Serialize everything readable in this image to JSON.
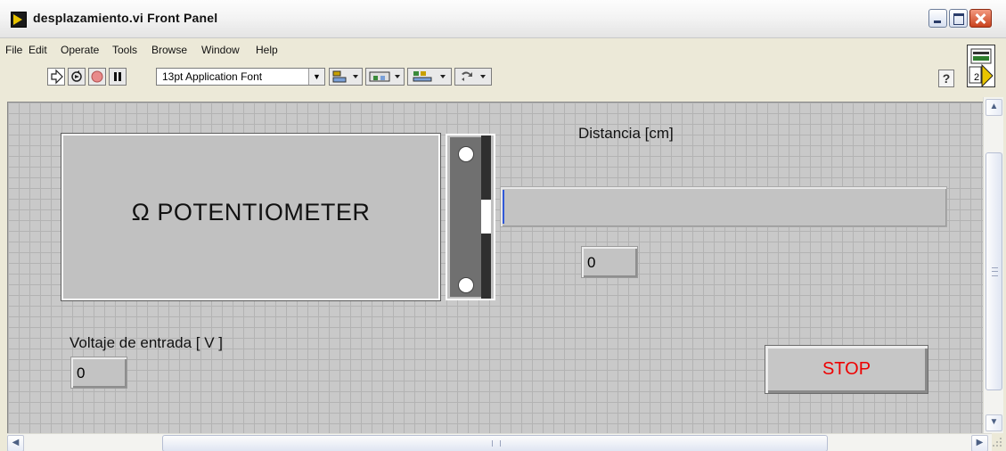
{
  "window": {
    "title": "desplazamiento.vi Front Panel"
  },
  "menu": [
    "File",
    "Edit",
    "Operate",
    "Tools",
    "Browse",
    "Window",
    "Help"
  ],
  "toolbar": {
    "font": "13pt Application Font",
    "help": "?",
    "connector_number": "2"
  },
  "panel": {
    "potentiometer_label": "Ω POTENTIOMETER",
    "distance_label": "Distancia [cm]",
    "distance_value": "0",
    "distance_bar_fraction": 0.0,
    "voltage_label": "Voltaje de entrada [ V ]",
    "voltage_value": "0",
    "stop_label": "STOP"
  },
  "colors": {
    "grid_bg": "#c9c9c9",
    "stop_text": "#ee0000",
    "bar_fill": "#3058d8"
  }
}
